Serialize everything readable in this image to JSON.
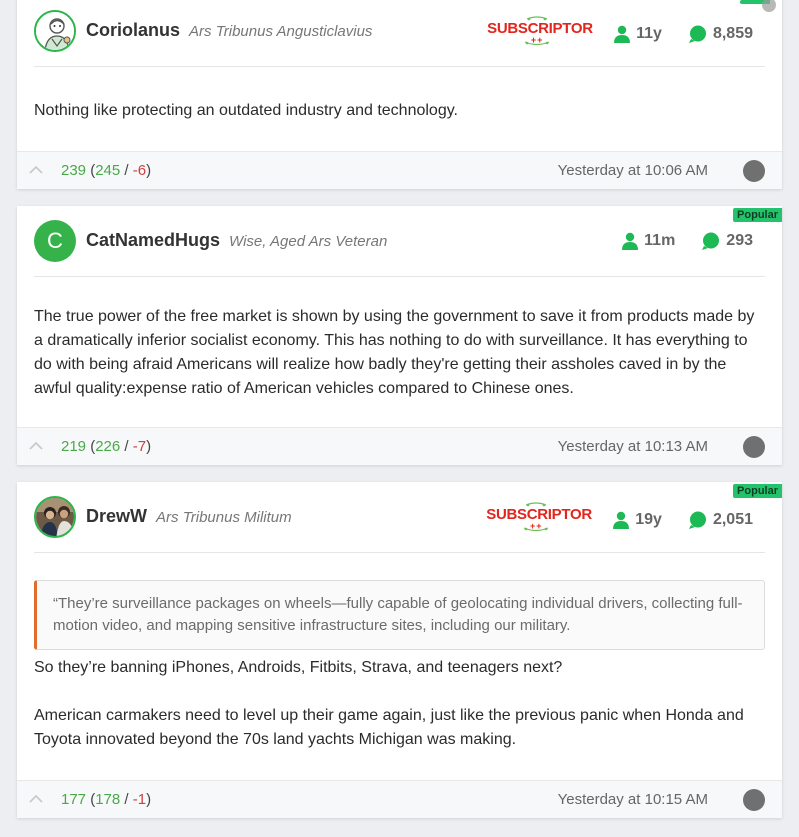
{
  "colors": {
    "accent_green": "#1db954",
    "vote_green": "#4aa84a",
    "vote_red": "#d04040",
    "subscriptor_red": "#e2261d",
    "quote_border": "#e06c2d",
    "popular_badge": "#23c36b"
  },
  "comments": [
    {
      "username": "Coriolanus",
      "usertitle": "Ars Tribunus Angusticlavius",
      "subscriptor": "SUBSCRIPTOR",
      "subscriptor_plus": "++",
      "tenure": "11y",
      "post_count": "8,859",
      "avatar_icon": "cartoon-avatar-icon",
      "text": "Nothing like protecting an outdated industry and technology.",
      "score": "239",
      "upvotes": "245",
      "downvotes": "-6",
      "timestamp": "Yesterday at 10:06 AM"
    },
    {
      "username": "CatNamedHugs",
      "usertitle": "Wise, Aged Ars Veteran",
      "avatar_letter": "C",
      "tenure": "11m",
      "post_count": "293",
      "badge": "Popular",
      "text": "The true power of the free market is shown by using the government to save it from products made by a dramatically inferior socialist economy. This has nothing to do with surveillance. It has everything to do with being afraid Americans will realize how badly they're getting their assholes caved in by the awful quality:expense ratio of American vehicles compared to Chinese ones.",
      "score": "219",
      "upvotes": "226",
      "downvotes": "-7",
      "timestamp": "Yesterday at 10:13 AM"
    },
    {
      "username": "DrewW",
      "usertitle": "Ars Tribunus Militum",
      "subscriptor": "SUBSCRIPTOR",
      "subscriptor_plus": "++",
      "tenure": "19y",
      "post_count": "2,051",
      "badge": "Popular",
      "avatar_icon": "photo-avatar-icon",
      "quote": "“They’re surveillance packages on wheels—fully capable of geolocating individual drivers, collecting full-motion video, and mapping sensitive infrastructure sites, including our military.",
      "text_p1": "So they’re banning iPhones, Androids, Fitbits, Strava, and teenagers next?",
      "text_p2": "American carmakers need to level up their game again, just like the previous panic when Honda and Toyota innovated beyond the 70s land yachts Michigan was making.",
      "score": "177",
      "upvotes": "178",
      "downvotes": "-1",
      "timestamp": "Yesterday at 10:15 AM"
    }
  ]
}
